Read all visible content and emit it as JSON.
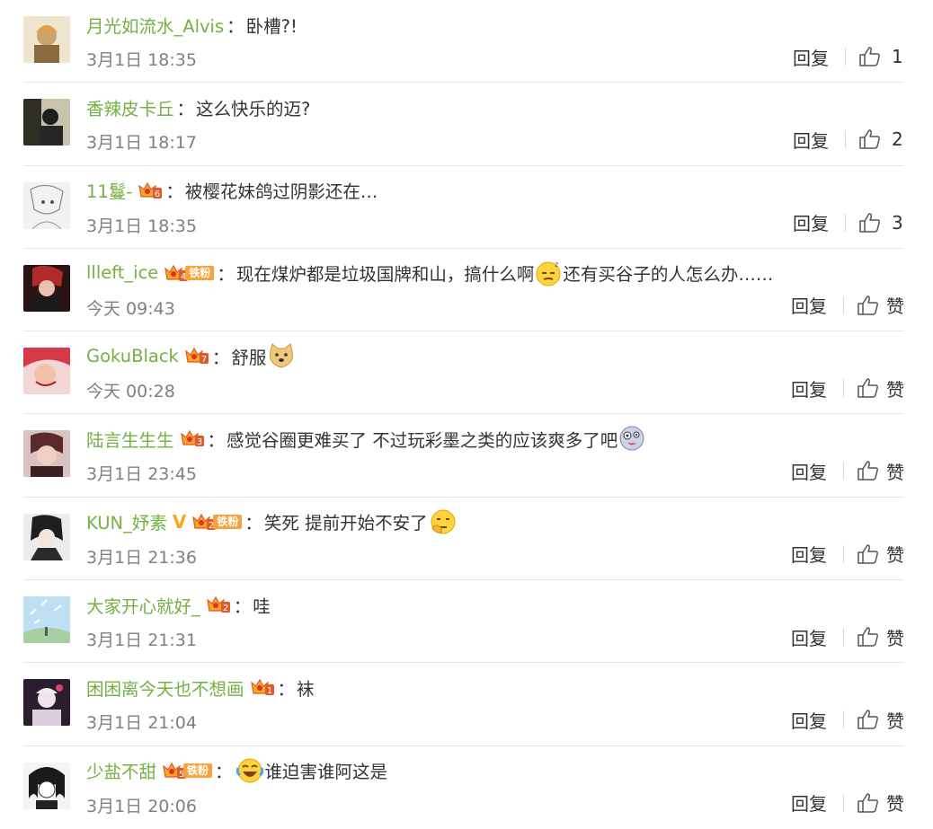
{
  "actions": {
    "reply_label": "回复"
  },
  "comments": [
    {
      "user": "月光如流水_Alvis",
      "colon": "：",
      "text": "卧槽?!",
      "time": "3月1日 18:35",
      "likes": "1",
      "avatar_color": "#c9a36b"
    },
    {
      "user": "香辣皮卡丘",
      "colon": "：",
      "text": "这么快乐的迈?",
      "time": "3月1日 18:17",
      "likes": "2",
      "avatar_color": "#3a3a2e"
    },
    {
      "user": "11鬘-",
      "colon": "：",
      "text": "被樱花妹鸽过阴影还在…",
      "time": "3月1日 18:35",
      "likes": "3",
      "avatar_color": "#d8d8d8",
      "badge_level": "6"
    },
    {
      "user": "llleft_ice",
      "colon": "：",
      "text": "现在煤炉都是垃圾国牌和山，搞什么啊",
      "text2": "还有买谷子的人怎么办……",
      "time": "今天 09:43",
      "likes": "赞",
      "avatar_color": "#7a1f1f",
      "badge_level": "4",
      "fan_label": "铁粉"
    },
    {
      "user": "GokuBlack",
      "colon": "：",
      "text": "舒服",
      "time": "今天 00:28",
      "likes": "赞",
      "avatar_color": "#c83a3a",
      "badge_level": "7"
    },
    {
      "user": "陆言生生生",
      "colon": "：",
      "text": "感觉谷圈更难买了 不过玩彩墨之类的应该爽多了吧",
      "time": "3月1日 23:45",
      "likes": "赞",
      "avatar_color": "#6b3b3b",
      "badge_level": "3"
    },
    {
      "user": "KUN_妤素",
      "colon": "：",
      "text": "笑死 提前开始不安了",
      "time": "3月1日 21:36",
      "likes": "赞",
      "avatar_color": "#2a2a2a",
      "badge_level": "2",
      "fan_label": "铁粉",
      "verified": "V"
    },
    {
      "user": "大家开心就好_",
      "colon": "：",
      "text": "哇",
      "time": "3月1日 21:31",
      "likes": "赞",
      "avatar_color": "#9cc3e0",
      "badge_level": "2"
    },
    {
      "user": "困困离今天也不想画",
      "colon": "：",
      "text": "袜",
      "time": "3月1日 21:04",
      "likes": "赞",
      "avatar_color": "#3b2a3a",
      "badge_level": "1"
    },
    {
      "user": "少盐不甜",
      "colon": "：",
      "text": "谁迫害谁阿这是",
      "time": "3月1日 20:06",
      "likes": "赞",
      "avatar_color": "#e8e8e8",
      "badge_level": "5",
      "fan_label": "铁粉"
    }
  ],
  "colors": {
    "username": "#74b045",
    "time": "#808080",
    "badge": "#f7a23b",
    "divider": "#e6e6e6"
  }
}
